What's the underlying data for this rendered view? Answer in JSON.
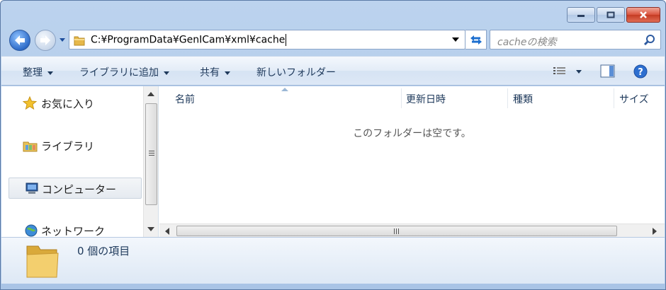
{
  "window": {
    "caption": {
      "minimize_icon": "minimize-icon",
      "maximize_icon": "maximize-icon",
      "close_icon": "close-icon"
    }
  },
  "navigation": {
    "address": "C:¥ProgramData¥GenICam¥xml¥cache",
    "search_placeholder": "cacheの検索"
  },
  "toolbar": {
    "organize": "整理",
    "add_to_library": "ライブラリに追加",
    "share": "共有",
    "new_folder": "新しいフォルダー"
  },
  "nav_pane": {
    "items": [
      {
        "label": "お気に入り",
        "icon": "star-icon"
      },
      {
        "label": "ライブラリ",
        "icon": "library-icon"
      },
      {
        "label": "コンピューター",
        "icon": "computer-icon"
      },
      {
        "label": "ネットワーク",
        "icon": "network-icon"
      }
    ],
    "selected": "コンピューター"
  },
  "file_list": {
    "columns": [
      "名前",
      "更新日時",
      "種類",
      "サイズ"
    ],
    "empty_message": "このフォルダーは空です。"
  },
  "details": {
    "item_count": "0 個の項目"
  },
  "colors": {
    "window_frame": "#bcd3ee",
    "text": "#1e395b",
    "close_button": "#c53b23"
  }
}
